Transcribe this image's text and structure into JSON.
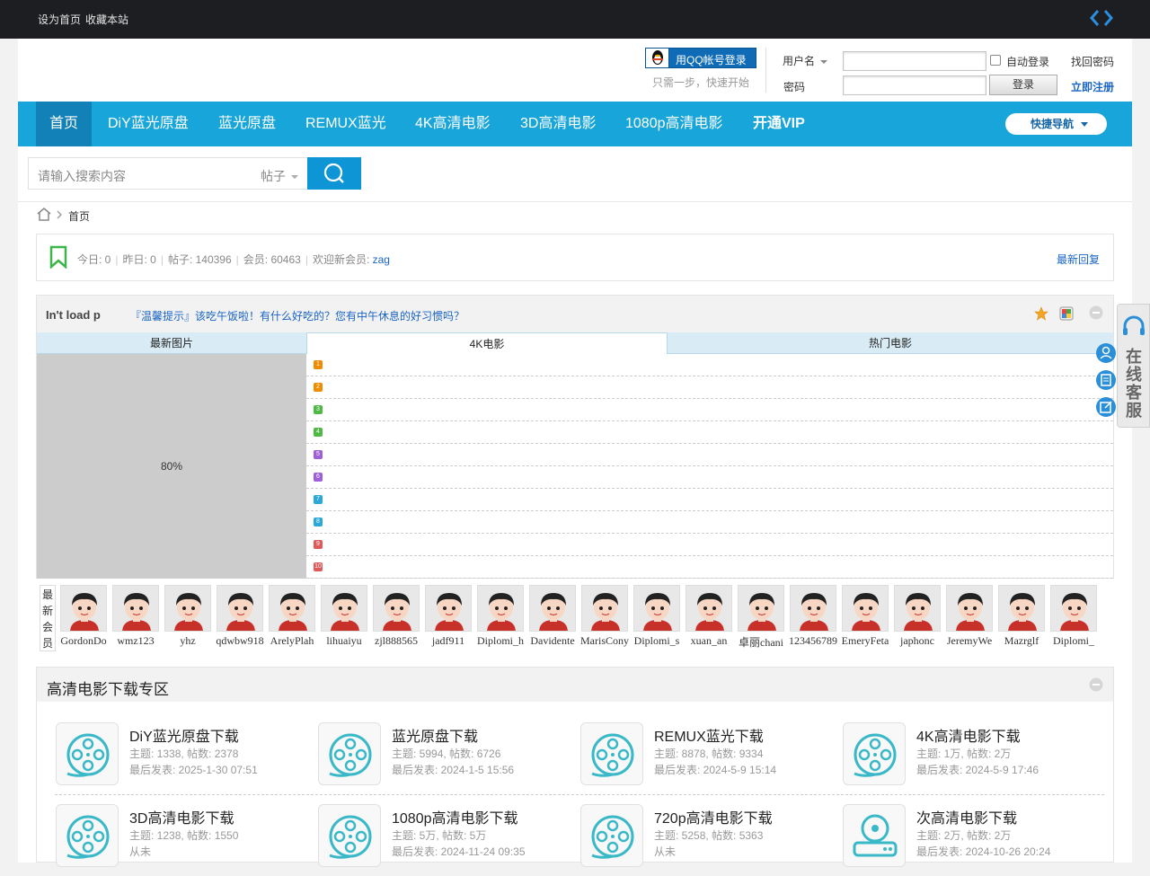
{
  "topbar": {
    "links": [
      "设为首页",
      "收藏本站"
    ]
  },
  "login": {
    "qq_button": "用QQ帐号登录",
    "qq_hint": "只需一步，快速开始",
    "username_label": "用户名",
    "password_label": "密码",
    "auto_login": "自动登录",
    "login_button": "登录",
    "find_password": "找回密码",
    "register": "立即注册"
  },
  "nav": {
    "items": [
      "首页",
      "DiY蓝光原盘",
      "蓝光原盘",
      "REMUX蓝光",
      "4K高清电影",
      "3D高清电影",
      "1080p高清电影",
      "开通VIP"
    ],
    "quick_nav": "快捷导航"
  },
  "search": {
    "placeholder": "请输入搜索内容",
    "type": "帖子"
  },
  "breadcrumb": {
    "home": "首页"
  },
  "stats": {
    "today": "今日: 0",
    "yesterday": "昨日: 0",
    "posts": "帖子: 140396",
    "members": "会员: 60463",
    "welcome": "欢迎新会员: ",
    "new_member": "zag",
    "latest_replies": "最新回复"
  },
  "notice": {
    "broken_image": "In't load p",
    "message": "『温馨提示』该吃午饭啦！有什么好吃的？您有中午休息的好习惯吗？",
    "tabs": [
      "最新图片",
      "4K电影",
      "热门电影"
    ],
    "image_progress": "80%",
    "list_numbers": [
      "1",
      "2",
      "3",
      "4",
      "5",
      "6",
      "7",
      "8",
      "9",
      "10"
    ]
  },
  "members": {
    "label": "最新会员",
    "names": [
      "GordonDo",
      "wmz123",
      "yhz",
      "qdwbw918",
      "ArelyPlah",
      "lihuaiyu",
      "zjl888565",
      "jadf911",
      "Diplomi_h",
      "Davidente",
      "MarisCony",
      "Diplomi_s",
      "xuan_an",
      "卓丽chani",
      "123456789",
      "EmeryFeta",
      "japhonc",
      "JeremyWe",
      "Mazrglf",
      "Diplomi_"
    ]
  },
  "forums": {
    "title": "高清电影下载专区",
    "items": [
      {
        "name": "DiY蓝光原盘下载",
        "stats": "主题: 1338, 帖数: 2378",
        "last": "最后发表: 2025-1-30 07:51"
      },
      {
        "name": "蓝光原盘下载",
        "stats": "主题: 5994, 帖数: 6726",
        "last": "最后发表: 2024-1-5 15:56"
      },
      {
        "name": "REMUX蓝光下载",
        "stats": "主题: 8878, 帖数: 9334",
        "last": "最后发表: 2024-5-9 15:14"
      },
      {
        "name": "4K高清电影下载",
        "stats": "主题: 1万, 帖数: 2万",
        "last": "最后发表: 2024-5-9 17:46"
      },
      {
        "name": "3D高清电影下载",
        "stats": "主题: 1238, 帖数: 1550",
        "last": "从未"
      },
      {
        "name": "1080p高清电影下载",
        "stats": "主题: 5万, 帖数: 5万",
        "last": "最后发表: 2024-11-24 09:35"
      },
      {
        "name": "720p高清电影下载",
        "stats": "主题: 5258, 帖数: 5363",
        "last": "从未"
      },
      {
        "name": "次高清电影下载",
        "stats": "主题: 2万, 帖数: 2万",
        "last": "最后发表: 2024-10-26 20:24"
      }
    ]
  },
  "service": {
    "label": "在线客服"
  },
  "colors": {
    "nav": "#18a5d9",
    "nav_active": "#1281b8",
    "link": "#1a64c4",
    "search_button": "#0d95d6"
  }
}
